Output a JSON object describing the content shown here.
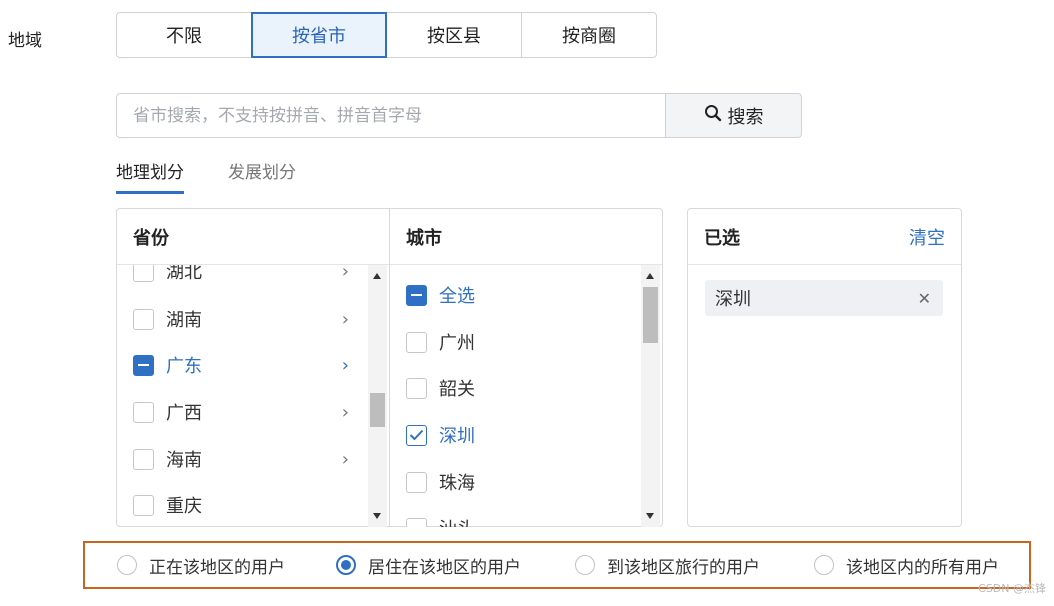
{
  "region": {
    "label": "地域"
  },
  "scope_tabs": [
    "不限",
    "按省市",
    "按区县",
    "按商圈"
  ],
  "search": {
    "placeholder": "省市搜索，不支持按拼音、拼音首字母",
    "button_label": "搜索"
  },
  "sub_tabs": [
    "地理划分",
    "发展划分"
  ],
  "province_panel": {
    "title": "省份",
    "items": [
      {
        "label": "湖北",
        "state": "unchecked",
        "has_arrow": true
      },
      {
        "label": "湖南",
        "state": "unchecked",
        "has_arrow": true
      },
      {
        "label": "广东",
        "state": "indeterminate",
        "has_arrow": true
      },
      {
        "label": "广西",
        "state": "unchecked",
        "has_arrow": true
      },
      {
        "label": "海南",
        "state": "unchecked",
        "has_arrow": true
      },
      {
        "label": "重庆",
        "state": "unchecked",
        "has_arrow": false
      }
    ]
  },
  "city_panel": {
    "title": "城市",
    "items": [
      {
        "label": "全选",
        "state": "indeterminate"
      },
      {
        "label": "广州",
        "state": "unchecked"
      },
      {
        "label": "韶关",
        "state": "unchecked"
      },
      {
        "label": "深圳",
        "state": "checked"
      },
      {
        "label": "珠海",
        "state": "unchecked"
      },
      {
        "label": "汕头",
        "state": "unchecked"
      }
    ]
  },
  "selected_panel": {
    "title": "已选",
    "clear_label": "清空",
    "tags": [
      "深圳"
    ]
  },
  "user_scope": {
    "options": [
      "正在该地区的用户",
      "居住在该地区的用户",
      "到该地区旅行的用户",
      "该地区内的所有用户"
    ],
    "selected": "居住在该地区的用户"
  },
  "watermark": "CSDN @杰锋",
  "colors": {
    "accent": "#2f6fc4",
    "highlight_border": "#c8661f"
  }
}
